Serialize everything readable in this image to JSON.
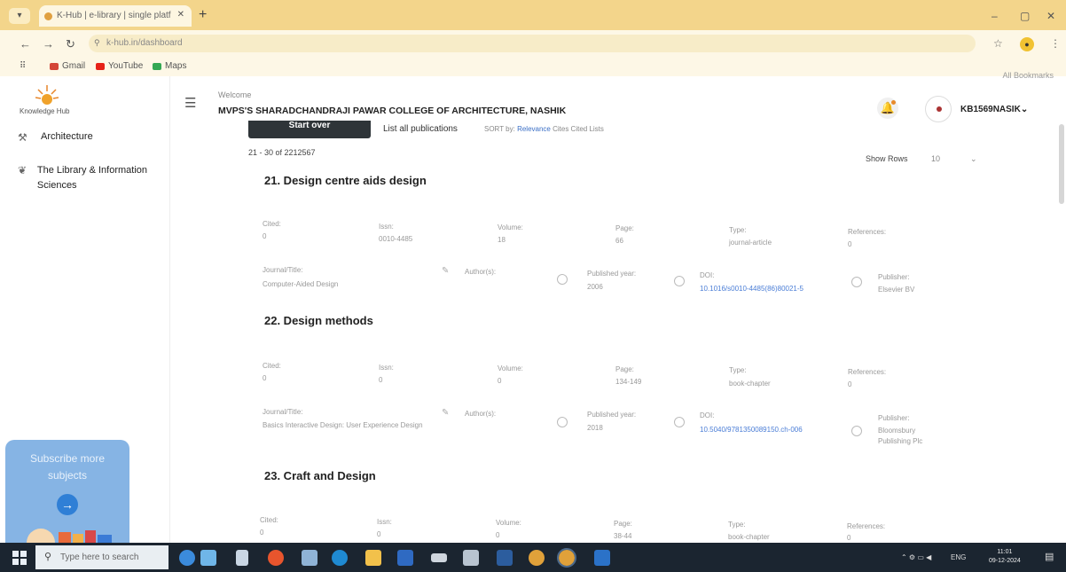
{
  "browser": {
    "tab_title": "K-Hub | e-library | single platf",
    "url": "k-hub.in/dashboard",
    "bookmarks": [
      {
        "label": "Gmail",
        "color": "#d44638"
      },
      {
        "label": "YouTube",
        "color": "#e62117"
      },
      {
        "label": "Maps",
        "color": "#34a853"
      }
    ],
    "all_bookmarks": "All Bookmarks"
  },
  "sidebar": {
    "logo_text": "Knowledge Hub",
    "items": [
      {
        "label": "Architecture",
        "icon": "architecture-icon"
      },
      {
        "label": "The Library & Information Sciences",
        "icon": "library-icon"
      }
    ],
    "subscribe_text": "Subscribe more subjects"
  },
  "header": {
    "welcome": "Welcome",
    "college": "MVPS'S SHARADCHANDRAJI PAWAR COLLEGE OF ARCHITECTURE, NASHIK",
    "username": "KB1569NASIK"
  },
  "toolbar": {
    "start_over": "Start over",
    "list_all": "List all publications",
    "sort_prefix": "SORT by:",
    "sort_selected": "Relevance",
    "sort_rest": "Cites Cited Lists",
    "range": "21 - 30 of 2212567",
    "show_rows_label": "Show Rows",
    "show_rows_value": "10"
  },
  "labels": {
    "cited": "Cited:",
    "issn": "Issn:",
    "volume": "Volume:",
    "page": "Page:",
    "type": "Type:",
    "references": "References:",
    "journal": "Journal/Title:",
    "authors": "Author(s):",
    "published": "Published year:",
    "doi": "DOI:",
    "publisher": "Publisher:"
  },
  "publications": [
    {
      "title": "21. Design centre aids design",
      "cited": "0",
      "issn": "0010-4485",
      "volume": "18",
      "page": "66",
      "type": "journal-article",
      "references": "0",
      "journal": "Computer-Aided Design",
      "published": "2006",
      "doi": "10.1016/s0010-4485(86)80021-5",
      "publisher": "Elsevier BV"
    },
    {
      "title": "22. Design methods",
      "cited": "0",
      "issn": "0",
      "volume": "0",
      "page": "134-149",
      "type": "book-chapter",
      "references": "0",
      "journal": "Basics Interactive Design: User Experience Design",
      "published": "2018",
      "doi": "10.5040/9781350089150.ch-006",
      "publisher": "Bloomsbury Publishing Plc"
    },
    {
      "title": "23. Craft and Design",
      "cited": "0",
      "issn": "0",
      "volume": "0",
      "page": "38-44",
      "type": "book-chapter",
      "references": "0"
    }
  ],
  "taskbar": {
    "search_placeholder": "Type here to search",
    "lang": "ENG",
    "time": "11:01",
    "date": "09-12-2024"
  }
}
